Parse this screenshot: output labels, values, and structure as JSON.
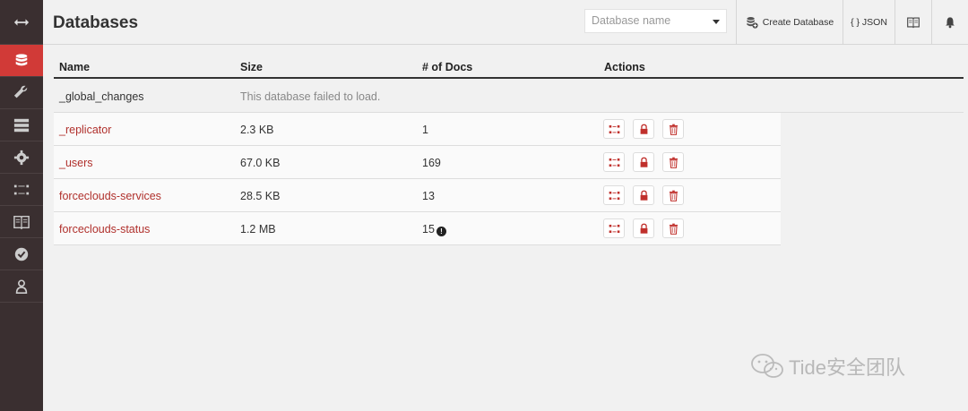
{
  "sidebar": {
    "items": [
      {
        "name": "toggle-sidebar",
        "icon": "double-arrow-icon"
      },
      {
        "name": "databases",
        "icon": "database-icon",
        "active": true
      },
      {
        "name": "setup",
        "icon": "wrench-icon"
      },
      {
        "name": "active-tasks",
        "icon": "tasks-icon"
      },
      {
        "name": "config",
        "icon": "gear-icon"
      },
      {
        "name": "replication",
        "icon": "replication-icon"
      },
      {
        "name": "documentation",
        "icon": "book-icon"
      },
      {
        "name": "verify",
        "icon": "checkmark-icon"
      },
      {
        "name": "user",
        "icon": "user-icon"
      }
    ]
  },
  "header": {
    "title": "Databases",
    "db_select_placeholder": "Database name",
    "create_database_label": "Create Database",
    "json_label": "{ } JSON"
  },
  "table": {
    "columns": [
      "Name",
      "Size",
      "# of Docs",
      "Actions"
    ],
    "rows": [
      {
        "name": "_global_changes",
        "error": "This database failed to load."
      },
      {
        "name": "_replicator",
        "size": "2.3 KB",
        "docs": "1"
      },
      {
        "name": "_users",
        "size": "67.0 KB",
        "docs": "169"
      },
      {
        "name": "forceclouds-services",
        "size": "28.5 KB",
        "docs": "13"
      },
      {
        "name": "forceclouds-status",
        "size": "1.2 MB",
        "docs": "15",
        "docs_warning": "!"
      }
    ]
  },
  "watermark": {
    "text": "Tide安全团队"
  },
  "colors": {
    "accent": "#d13a37",
    "sidebar": "#3a2f30",
    "link": "#b0302c"
  }
}
